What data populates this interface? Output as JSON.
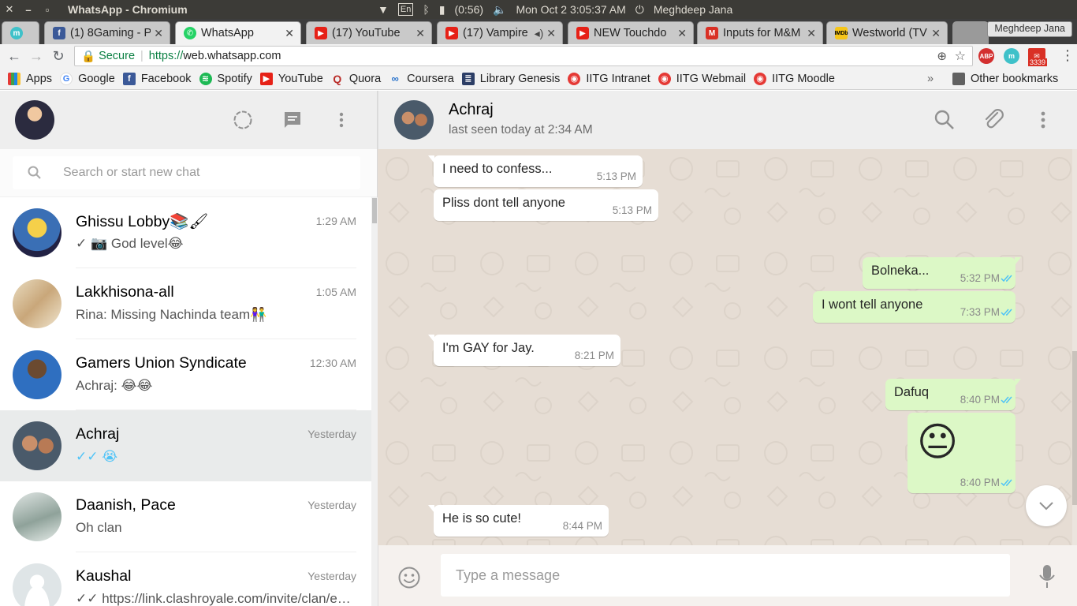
{
  "os": {
    "window_title": "WhatsApp - Chromium",
    "lang": "En",
    "battery": "(0:56)",
    "datetime": "Mon Oct  2  3:05:37 AM",
    "user": "Meghdeep Jana"
  },
  "browser": {
    "tabs": [
      {
        "label": "(1) 8Gaming - P",
        "icon": "facebook-icon",
        "color": "#3b5998"
      },
      {
        "label": "WhatsApp",
        "icon": "whatsapp-icon",
        "color": "#25d366"
      },
      {
        "label": "(17) YouTube",
        "icon": "youtube-icon",
        "color": "#e62117"
      },
      {
        "label": "(17) Vampire",
        "icon": "youtube-icon",
        "color": "#e62117"
      },
      {
        "label": "NEW Touchdo",
        "icon": "youtube-icon",
        "color": "#e62117"
      },
      {
        "label": "Inputs for M&M",
        "icon": "gmail-icon",
        "color": "#d93025"
      },
      {
        "label": "Westworld (TV",
        "icon": "imdb-icon",
        "color": "#f5c518"
      }
    ],
    "profile_name": "Meghdeep Jana",
    "url_secure": "Secure",
    "url_protocol": "https://",
    "url_host": "web.whatsapp.com",
    "gmail_count": "3339",
    "ext_abp": "ABP",
    "bookmarks": [
      {
        "label": "Apps",
        "icon": "apps-icon"
      },
      {
        "label": "Google",
        "icon": "google-icon"
      },
      {
        "label": "Facebook",
        "icon": "facebook-icon"
      },
      {
        "label": "Spotify",
        "icon": "spotify-icon"
      },
      {
        "label": "YouTube",
        "icon": "youtube-icon"
      },
      {
        "label": "Quora",
        "icon": "quora-icon"
      },
      {
        "label": "Coursera",
        "icon": "coursera-icon"
      },
      {
        "label": "Library Genesis",
        "icon": "library-icon"
      },
      {
        "label": "IITG Intranet",
        "icon": "iitg-icon"
      },
      {
        "label": "IITG Webmail",
        "icon": "iitg-icon"
      },
      {
        "label": "IITG Moodle",
        "icon": "iitg-icon"
      }
    ],
    "other_bookmarks": "Other bookmarks"
  },
  "sidebar": {
    "search_placeholder": "Search or start new chat",
    "chats": [
      {
        "name": "Ghissu Lobby📚🖌",
        "time": "1:29 AM",
        "preview": "✓ 📷 God level😂"
      },
      {
        "name": "Lakkhisona-all",
        "time": "1:05 AM",
        "preview": "Rina: Missing Nachinda team👫"
      },
      {
        "name": "Gamers Union Syndicate",
        "time": "12:30 AM",
        "preview": "Achraj: 😂😂"
      },
      {
        "name": "Achraj",
        "time": "Yesterday",
        "preview": "✓✓ 😭"
      },
      {
        "name": "Daanish, Pace",
        "time": "Yesterday",
        "preview": "Oh clan"
      },
      {
        "name": "Kaushal",
        "time": "Yesterday",
        "preview": "✓✓ https://link.clashroyale.com/invite/clan/en?tag=..."
      }
    ]
  },
  "conversation": {
    "contact_name": "Achraj",
    "status": "last seen today at 2:34 AM",
    "messages": [
      {
        "dir": "in",
        "text": "I need to confess...",
        "time": "5:13 PM"
      },
      {
        "dir": "in",
        "text": "Pliss dont tell anyone",
        "time": "5:13 PM"
      },
      {
        "dir": "out",
        "text": "Bolneka...",
        "time": "5:32 PM"
      },
      {
        "dir": "out",
        "text": "I wont tell anyone",
        "time": "7:33 PM"
      },
      {
        "dir": "in",
        "text": "I'm GAY for Jay.",
        "time": "8:21 PM"
      },
      {
        "dir": "out",
        "text": "Dafuq",
        "time": "8:40 PM"
      },
      {
        "dir": "out",
        "text": "😐",
        "time": "8:40 PM"
      },
      {
        "dir": "in",
        "text": "He is so cute!",
        "time": "8:44 PM"
      }
    ],
    "composer_placeholder": "Type a message"
  },
  "colors": {
    "whatsapp_green": "#25d366",
    "outgoing_bubble": "#dcf8c6",
    "read_tick": "#4fc3f7",
    "chat_background": "#e6ddd4"
  }
}
